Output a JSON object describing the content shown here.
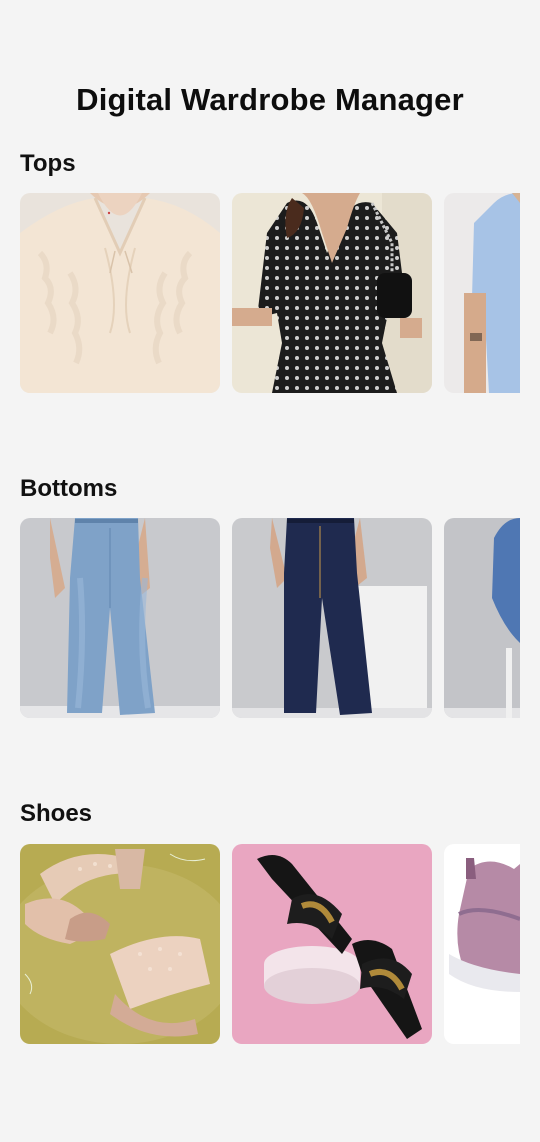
{
  "app": {
    "title": "Digital Wardrobe Manager"
  },
  "sections": [
    {
      "label": "Tops",
      "items": [
        {
          "icon": "ruffled-blouse-photo"
        },
        {
          "icon": "printed-peplum-top-photo"
        },
        {
          "icon": "blue-tshirt-photo"
        }
      ]
    },
    {
      "label": "Bottoms",
      "items": [
        {
          "icon": "light-wash-jeans-photo"
        },
        {
          "icon": "dark-wash-jeans-photo"
        },
        {
          "icon": "blue-jeans-partial-photo"
        }
      ]
    },
    {
      "label": "Shoes",
      "items": [
        {
          "icon": "embellished-heels-photo"
        },
        {
          "icon": "black-chain-slides-photo"
        },
        {
          "icon": "pink-sneaker-photo"
        }
      ]
    }
  ],
  "colors": {
    "background": "#f4f4f4",
    "text": "#0d0d0d"
  }
}
